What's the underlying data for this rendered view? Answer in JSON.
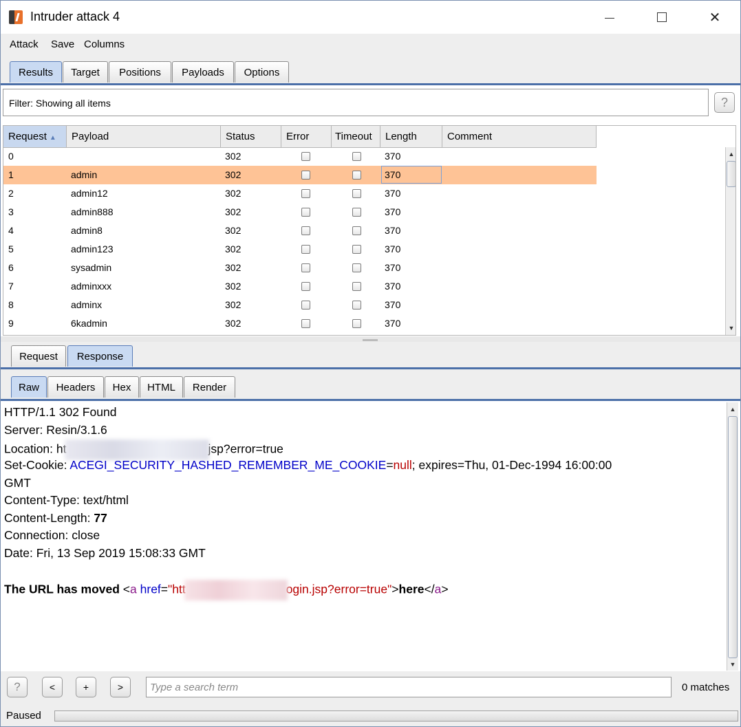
{
  "window": {
    "title": "Intruder attack 4"
  },
  "menu": [
    "Attack",
    "Save",
    "Columns"
  ],
  "main_tabs": [
    {
      "label": "Results",
      "active": true
    },
    {
      "label": "Target",
      "active": false
    },
    {
      "label": "Positions",
      "active": false
    },
    {
      "label": "Payloads",
      "active": false
    },
    {
      "label": "Options",
      "active": false
    }
  ],
  "filter": {
    "text": "Filter: Showing all items"
  },
  "help_label": "?",
  "table": {
    "columns": [
      "Request",
      "Payload",
      "Status",
      "Error",
      "Timeout",
      "Length",
      "Comment"
    ],
    "sort_indicator": "▲",
    "rows": [
      {
        "request": "0",
        "payload": "",
        "status": "302",
        "length": "370"
      },
      {
        "request": "1",
        "payload": "admin",
        "status": "302",
        "length": "370"
      },
      {
        "request": "2",
        "payload": "admin12",
        "status": "302",
        "length": "370"
      },
      {
        "request": "3",
        "payload": "admin888",
        "status": "302",
        "length": "370"
      },
      {
        "request": "4",
        "payload": "admin8",
        "status": "302",
        "length": "370"
      },
      {
        "request": "5",
        "payload": "admin123",
        "status": "302",
        "length": "370"
      },
      {
        "request": "6",
        "payload": "sysadmin",
        "status": "302",
        "length": "370"
      },
      {
        "request": "7",
        "payload": "adminxxx",
        "status": "302",
        "length": "370"
      },
      {
        "request": "8",
        "payload": "adminx",
        "status": "302",
        "length": "370"
      },
      {
        "request": "9",
        "payload": "6kadmin",
        "status": "302",
        "length": "370"
      }
    ],
    "selected_row": 1
  },
  "detail_tabs": [
    {
      "label": "Request",
      "active": false
    },
    {
      "label": "Response",
      "active": true
    }
  ],
  "view_tabs": [
    {
      "label": "Raw",
      "active": true
    },
    {
      "label": "Headers",
      "active": false
    },
    {
      "label": "Hex",
      "active": false
    },
    {
      "label": "HTML",
      "active": false
    },
    {
      "label": "Render",
      "active": false
    }
  ],
  "response": {
    "status_line": "HTTP/1.1 302 Found",
    "server": "Server: Resin/3.1.6",
    "location_prefix": "Location: ht",
    "location_suffix": "jsp?error=true",
    "cookie_key": "Set-Cookie: ",
    "cookie_name": "ACEGI_SECURITY_HASHED_REMEMBER_ME_COOKIE",
    "cookie_eq": "=",
    "cookie_value": "null",
    "cookie_rest": "; expires=Thu, 01-Dec-1994 16:00:00",
    "cookie_wrap": "GMT",
    "content_type": "Content-Type: text/html",
    "content_length_key": "Content-Length: ",
    "content_length_value": "77",
    "connection": "Connection: close",
    "date": "Date: Fri, 13 Sep 2019 15:08:33 GMT",
    "body_bold": "The URL has moved",
    "body_lt": "<",
    "body_tag_a": "a",
    "body_attr": " href",
    "body_eq": "=",
    "body_url_prefix": "\"htt",
    "body_url_suffix": "ogin.jsp?error=true\"",
    "body_gt": ">",
    "body_link_text": "here",
    "body_close_lt": "</",
    "body_close_a": "a",
    "body_close_gt": ">"
  },
  "search": {
    "placeholder": "Type a search term",
    "matches": "0 matches"
  },
  "nav_buttons": {
    "help": "?",
    "prev": "<",
    "add": "+",
    "next": ">"
  },
  "status": {
    "text": "Paused"
  }
}
